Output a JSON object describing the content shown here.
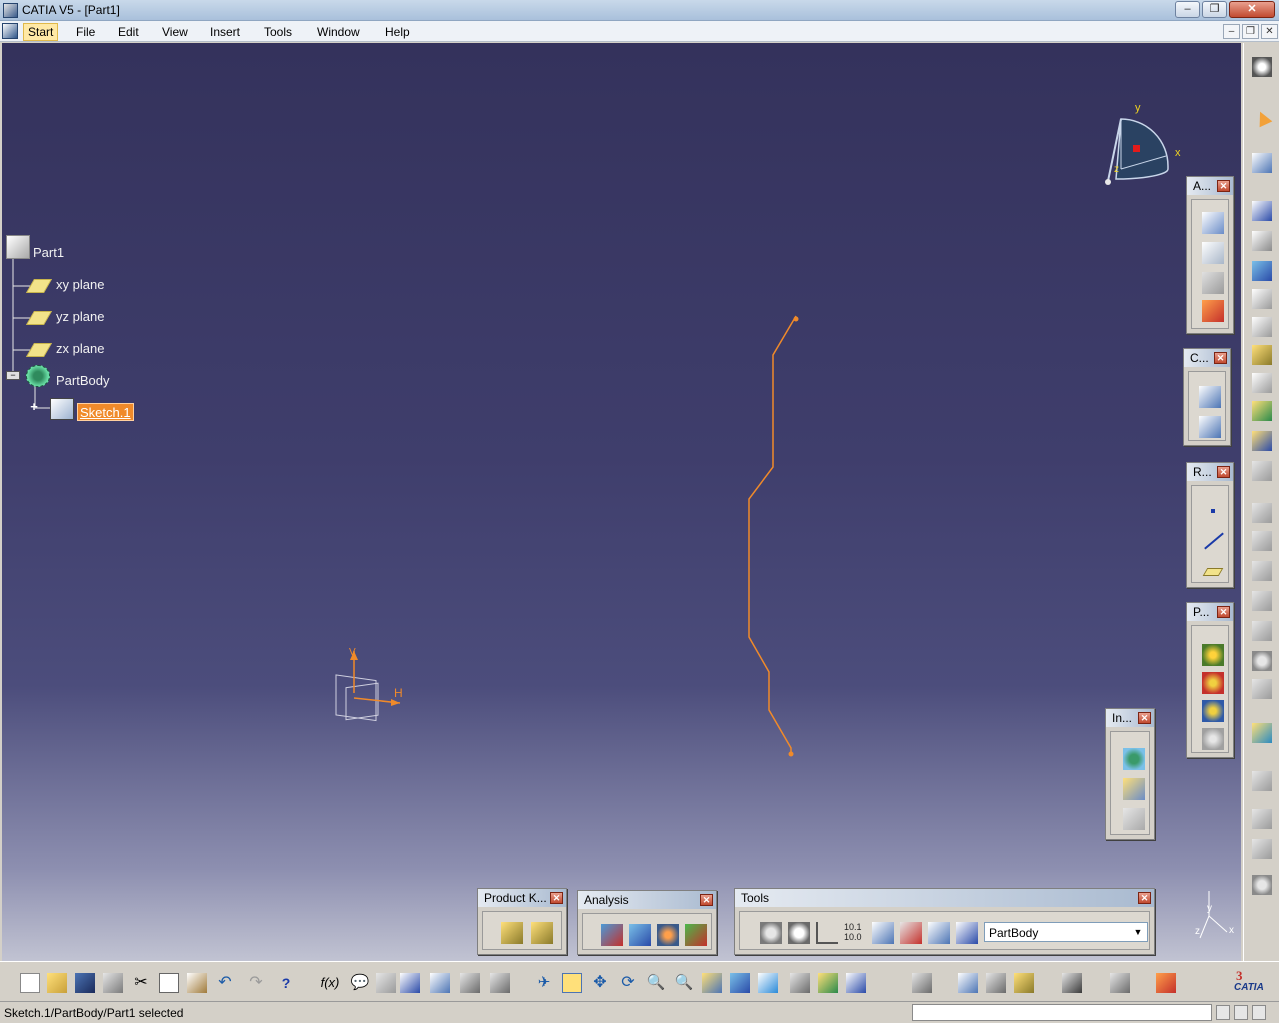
{
  "window": {
    "title": "CATIA V5 - [Part1]"
  },
  "menu": [
    {
      "label": "Start",
      "active": true
    },
    {
      "label": "File"
    },
    {
      "label": "Edit"
    },
    {
      "label": "View"
    },
    {
      "label": "Insert"
    },
    {
      "label": "Tools"
    },
    {
      "label": "Window"
    },
    {
      "label": "Help"
    }
  ],
  "tree": {
    "root": "Part1",
    "planes": [
      "xy plane",
      "yz plane",
      "zx plane"
    ],
    "body": "PartBody",
    "sketch": "Sketch.1"
  },
  "compass": {
    "x_label": "x",
    "y_label": "y",
    "z_label": "z"
  },
  "sketch_axes": {
    "h_label": "H",
    "v_label": "V"
  },
  "corner_axes": {
    "x_label": "x",
    "y_label": "y",
    "z_label": "z"
  },
  "palettes": {
    "annotations": "A...",
    "constraint": "C...",
    "reference": "R...",
    "profile": "P...",
    "insert": "In...",
    "product_knowledge": "Product K...",
    "analysis": "Analysis",
    "tools": "Tools"
  },
  "tools_dropdown": {
    "value": "PartBody"
  },
  "status": {
    "text": "Sketch.1/PartBody/Part1 selected"
  },
  "brand": {
    "logo": "CATIA"
  },
  "colors": {
    "sketch_line": "#f08a2a",
    "selection": "#f08a2a",
    "viewport_top": "#34325c",
    "viewport_bottom": "#c1c3d2"
  }
}
